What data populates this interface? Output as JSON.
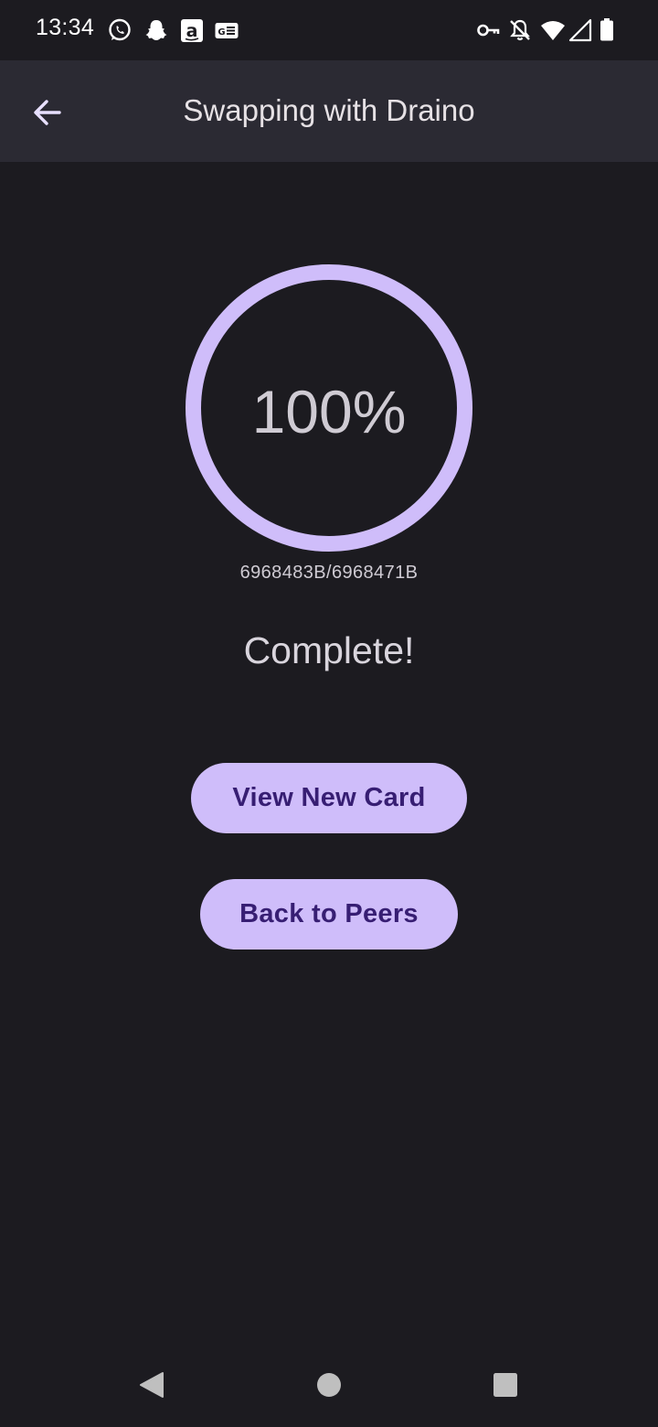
{
  "status_bar": {
    "time": "13:34",
    "left_icons": [
      "whatsapp-icon",
      "snapchat-icon",
      "amazon-icon",
      "news-icon"
    ],
    "right_icons": [
      "vpn-key-icon",
      "notifications-off-icon",
      "wifi-icon",
      "cell-signal-icon",
      "battery-icon"
    ]
  },
  "app_bar": {
    "title": "Swapping with Draino",
    "back_icon": "arrow-back-icon"
  },
  "progress": {
    "percent_text": "100%",
    "fraction": 1.0,
    "bytes_text": "6968483B/6968471B",
    "status": "Complete!"
  },
  "actions": {
    "view_new_card": "View New Card",
    "back_to_peers": "Back to Peers"
  },
  "colors": {
    "background": "#1c1b20",
    "app_bar": "#2b2a33",
    "accent": "#cfbdfa",
    "button_text": "#371e73"
  },
  "nav_bar": {
    "icons": [
      "back-triangle-icon",
      "home-circle-icon",
      "recents-square-icon"
    ]
  }
}
